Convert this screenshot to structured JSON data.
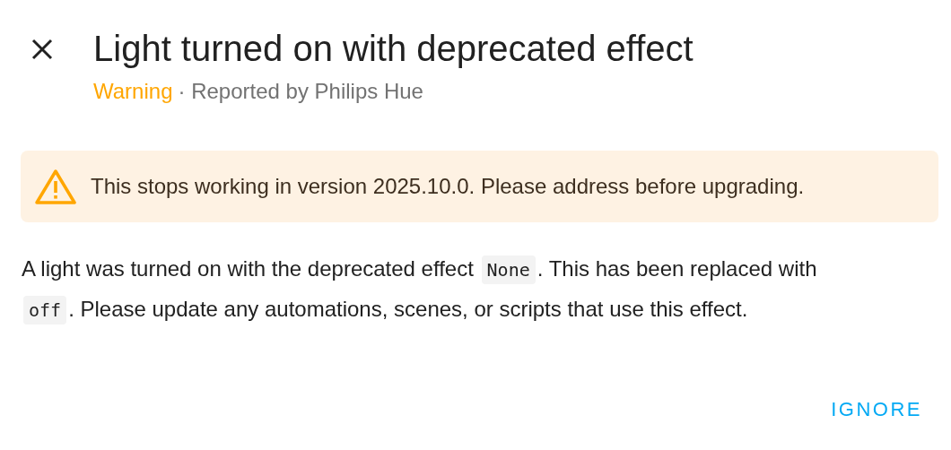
{
  "dialog": {
    "title": "Light turned on with deprecated effect",
    "subtitle": {
      "severity": {
        "label": "Warning",
        "kind": "warning"
      },
      "reporter": "· Reported by Philips Hue"
    },
    "alert": {
      "kind": "warning",
      "text": "This stops working in version 2025.10.0. Please address before upgrading."
    },
    "description": [
      {
        "kind": "text",
        "text": "A light was turned on with the deprecated effect "
      },
      {
        "kind": "code",
        "text": "None"
      },
      {
        "kind": "text",
        "text": ". This has been replaced with "
      },
      {
        "kind": "code",
        "text": "off"
      },
      {
        "kind": "text",
        "text": ". Please update any automations, scenes, or scripts that use this effect."
      }
    ],
    "buttons": [
      {
        "label": "IGNORE"
      }
    ]
  }
}
